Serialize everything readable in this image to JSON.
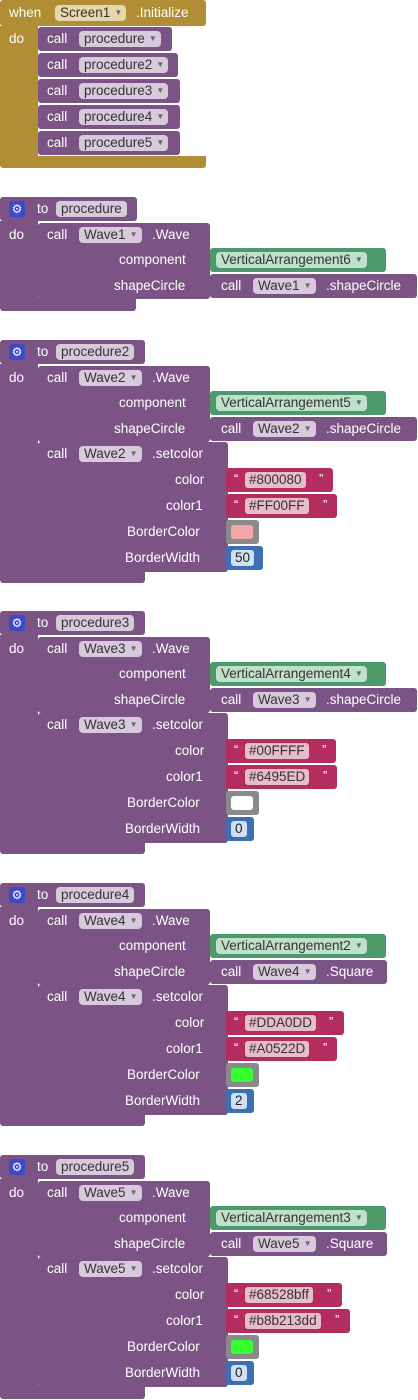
{
  "init_block": {
    "when": "when",
    "component": "Screen1",
    "event": ".Initialize",
    "do": "do",
    "calls": [
      {
        "call": "call",
        "proc": "procedure"
      },
      {
        "call": "call",
        "proc": "procedure2"
      },
      {
        "call": "call",
        "proc": "procedure3"
      },
      {
        "call": "call",
        "proc": "procedure4"
      },
      {
        "call": "call",
        "proc": "procedure5"
      }
    ]
  },
  "labels": {
    "to": "to",
    "do": "do",
    "call": "call",
    "wave_method": ".Wave",
    "setcolor": ".setcolor",
    "component": "component",
    "shapeCircle": "shapeCircle",
    "color": "color",
    "color1": "color1",
    "borderColor": "BorderColor",
    "borderWidth": "BorderWidth",
    "open_quote": "“",
    "close_quote": "”"
  },
  "procedures": [
    {
      "name": "procedure",
      "wave": "Wave1",
      "arrangement": "VerticalArrangement6",
      "shape": ".shapeCircle"
    },
    {
      "name": "procedure2",
      "wave": "Wave2",
      "arrangement": "VerticalArrangement5",
      "shape": ".shapeCircle",
      "color": "#800080",
      "color1": "#FF00FF",
      "border_color": "#f4a7a7",
      "border_width": "50"
    },
    {
      "name": "procedure3",
      "wave": "Wave3",
      "arrangement": "VerticalArrangement4",
      "shape": ".shapeCircle",
      "color": "#00FFFF",
      "color1": "#6495ED",
      "border_color": "#ffffff",
      "border_width": "0"
    },
    {
      "name": "procedure4",
      "wave": "Wave4",
      "arrangement": "VerticalArrangement2",
      "shape": ".Square",
      "color": "#DDA0DD",
      "color1": "#A0522D",
      "border_color": "#33ff33",
      "border_width": "2"
    },
    {
      "name": "procedure5",
      "wave": "Wave5",
      "arrangement": "VerticalArrangement3",
      "shape": ".Square",
      "color": "#68528bff",
      "color1": "#b8b213dd",
      "border_color": "#33ff33",
      "border_width": "0"
    }
  ]
}
